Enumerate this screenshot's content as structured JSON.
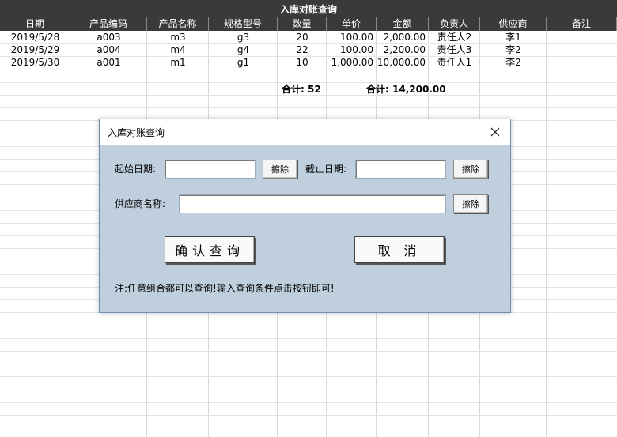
{
  "sheet_title": "入库对账查询",
  "columns": [
    "日期",
    "产品编码",
    "产品名称",
    "规格型号",
    "数量",
    "单价",
    "金额",
    "负责人",
    "供应商",
    "备注"
  ],
  "rows": [
    [
      "2019/5/28",
      "a003",
      "m3",
      "g3",
      "20",
      "100.00",
      "2,000.00",
      "责任人2",
      "李1",
      ""
    ],
    [
      "2019/5/29",
      "a004",
      "m4",
      "g4",
      "22",
      "100.00",
      "2,200.00",
      "责任人3",
      "李2",
      ""
    ],
    [
      "2019/5/30",
      "a001",
      "m1",
      "g1",
      "10",
      "1,000.00",
      "10,000.00",
      "责任人1",
      "李2",
      ""
    ]
  ],
  "totals": {
    "qty_label": "合计:",
    "qty_value": "52",
    "amount_label": "合计:",
    "amount_value": "14,200.00"
  },
  "dialog": {
    "title": "入库对账查询",
    "start_date_label": "起始日期:",
    "start_date_value": "",
    "end_date_label": "截止日期:",
    "end_date_value": "",
    "supplier_label": "供应商名称:",
    "supplier_value": "",
    "clear_label": "擦除",
    "confirm_label": "确认查询",
    "cancel_label": "取 消",
    "note": "注:任意组合都可以查询!输入查询条件点击按钮即可!"
  }
}
